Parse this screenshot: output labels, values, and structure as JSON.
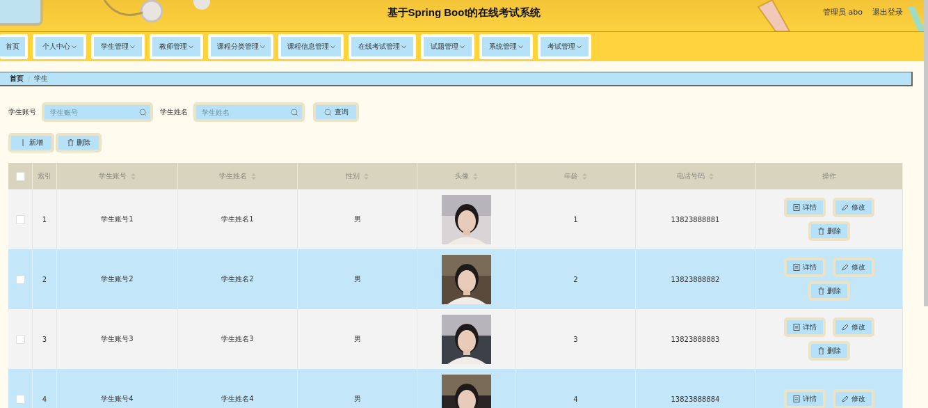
{
  "header": {
    "title": "基于Spring Boot的在线考试系统",
    "user": "管理员 abo",
    "logout": "退出登录"
  },
  "nav": [
    {
      "label": "首页",
      "dropdown": false
    },
    {
      "label": "个人中心",
      "dropdown": true
    },
    {
      "label": "学生管理",
      "dropdown": true
    },
    {
      "label": "教师管理",
      "dropdown": true
    },
    {
      "label": "课程分类管理",
      "dropdown": true
    },
    {
      "label": "课程信息管理",
      "dropdown": true
    },
    {
      "label": "在线考试管理",
      "dropdown": true
    },
    {
      "label": "试题管理",
      "dropdown": true
    },
    {
      "label": "系统管理",
      "dropdown": true
    },
    {
      "label": "考试管理",
      "dropdown": true
    }
  ],
  "breadcrumb": {
    "items": [
      "首页",
      "学生"
    ],
    "separator": "/"
  },
  "search": {
    "fields": [
      {
        "label": "学生账号",
        "placeholder": "学生账号"
      },
      {
        "label": "学生姓名",
        "placeholder": "学生姓名"
      }
    ],
    "button": "查询"
  },
  "actions": [
    {
      "kind": "add",
      "label": "新增"
    },
    {
      "kind": "delete",
      "label": "删除"
    }
  ],
  "table": {
    "header_checked": false,
    "columns": [
      {
        "label": "索引",
        "sortable": false
      },
      {
        "label": "学生账号",
        "sortable": true
      },
      {
        "label": "学生姓名",
        "sortable": true
      },
      {
        "label": "性别",
        "sortable": true
      },
      {
        "label": "头像",
        "sortable": true
      },
      {
        "label": "年龄",
        "sortable": true
      },
      {
        "label": "电话号码",
        "sortable": true
      },
      {
        "label": "操作",
        "sortable": false
      }
    ],
    "rows": [
      {
        "checked": false,
        "index": "1",
        "account": "学生账号1",
        "name": "学生姓名1",
        "gender": "男",
        "avatar": {
          "kind": "picture"
        },
        "age": "1",
        "phone": "13823888881",
        "actions": [
          {
            "kind": "detail",
            "label": "详情"
          },
          {
            "kind": "edit",
            "label": "修改"
          },
          {
            "kind": "delete",
            "label": "删除"
          }
        ]
      },
      {
        "checked": false,
        "index": "2",
        "account": "学生账号2",
        "name": "学生姓名2",
        "gender": "男",
        "avatar": {
          "kind": "picture"
        },
        "age": "2",
        "phone": "13823888882",
        "actions": [
          {
            "kind": "detail",
            "label": "详情"
          },
          {
            "kind": "edit",
            "label": "修改"
          },
          {
            "kind": "delete",
            "label": "删除"
          }
        ]
      },
      {
        "checked": false,
        "index": "3",
        "account": "学生账号3",
        "name": "学生姓名3",
        "gender": "男",
        "avatar": {
          "kind": "picture"
        },
        "age": "3",
        "phone": "13823888883",
        "actions": [
          {
            "kind": "detail",
            "label": "详情"
          },
          {
            "kind": "edit",
            "label": "修改"
          },
          {
            "kind": "delete",
            "label": "删除"
          }
        ]
      },
      {
        "checked": false,
        "index": "4",
        "account": "学生账号4",
        "name": "学生姓名4",
        "gender": "男",
        "avatar": {
          "kind": "picture"
        },
        "age": "4",
        "phone": "13823888884",
        "actions": [
          {
            "kind": "detail",
            "label": "详情"
          },
          {
            "kind": "edit",
            "label": "修改"
          }
        ]
      }
    ]
  }
}
